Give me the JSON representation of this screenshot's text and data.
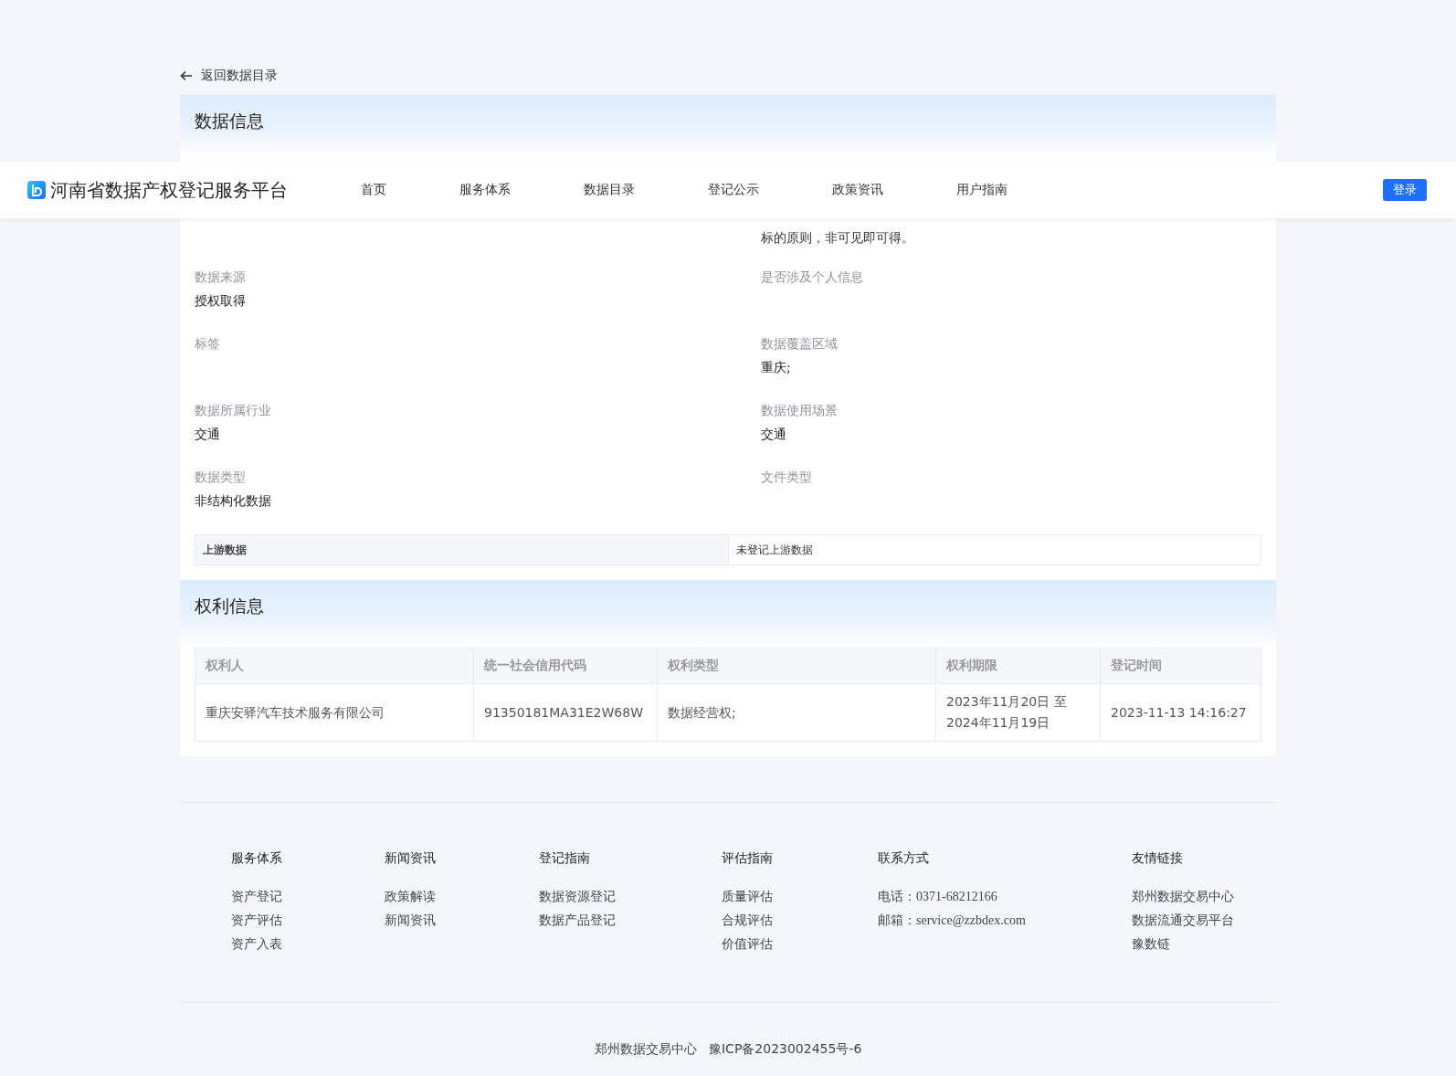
{
  "back_link": "返回数据目录",
  "header": {
    "title": "河南省数据产权登记服务平台",
    "nav": [
      {
        "label": "首页",
        "selected": false
      },
      {
        "label": "服务体系",
        "selected": false
      },
      {
        "label": "数据目录",
        "selected": false
      },
      {
        "label": "登记公示",
        "selected": false
      },
      {
        "label": "政策资讯",
        "selected": false
      },
      {
        "label": "用户指南",
        "selected": false
      }
    ],
    "login": "登录"
  },
  "data_info": {
    "title": "数据信息",
    "description_tail": "标的原则，非可见即可得。",
    "fields": [
      {
        "label": "数据来源",
        "value": "授权取得"
      },
      {
        "label": "是否涉及个人信息"
      },
      {
        "label": "标签"
      },
      {
        "label": "数据覆盖区域",
        "value": "重庆;"
      },
      {
        "label": "数据所属行业",
        "value": "交通"
      },
      {
        "label": "数据使用场景",
        "value": "交通"
      },
      {
        "label": "数据类型",
        "value": "非结构化数据"
      },
      {
        "label": "文件类型"
      }
    ],
    "upstream": {
      "label": "上游数据",
      "value": "未登记上游数据"
    }
  },
  "rights_info": {
    "title": "权利信息",
    "columns": [
      "权利人",
      "统一社会信用代码",
      "权利类型",
      "权利期限",
      "登记时间"
    ],
    "rows": [
      [
        "重庆安驿汽车技术服务有限公司",
        "91350181MA31E2W68W",
        "数据经营权;",
        "2023年11月20日 至 2024年11月19日",
        "2023-11-13 14:16:27"
      ]
    ]
  },
  "footer": {
    "columns": [
      {
        "heading": "服务体系",
        "items": [
          "资产登记",
          "资产评估",
          "资产入表"
        ]
      },
      {
        "heading": "新闻资讯",
        "items": [
          "政策解读",
          "新闻资讯"
        ]
      },
      {
        "heading": "登记指南",
        "items": [
          "数据资源登记",
          "数据产品登记"
        ]
      },
      {
        "heading": "评估指南",
        "items": [
          "质量评估",
          "合规评估",
          "价值评估"
        ]
      },
      {
        "heading": "联系方式",
        "items": [
          "电话：0371-68212166",
          "邮箱：service@zzbdex.com"
        ]
      },
      {
        "heading": "友情链接",
        "items": [
          "郑州数据交易中心",
          "数据流通交易平台",
          "豫数链"
        ]
      }
    ],
    "copyright": "郑州数据交易中心   豫ICP备2023002455号-6"
  }
}
